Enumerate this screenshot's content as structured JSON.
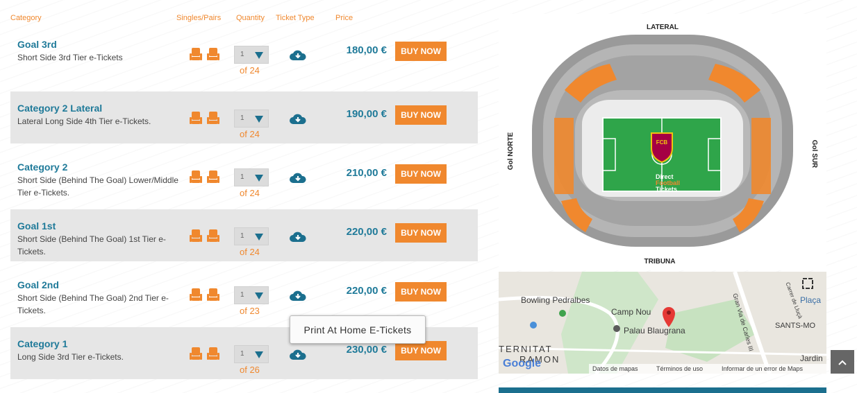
{
  "headers": {
    "category": "Category",
    "singles_pairs": "Singles/Pairs",
    "quantity": "Quantity",
    "ticket_type": "Ticket Type",
    "price": "Price"
  },
  "rows": [
    {
      "name": "Goal 3rd",
      "desc": "Short Side 3rd Tier e-Tickets",
      "qty": "1",
      "of": "of 24",
      "price": "180,00 €",
      "buy": "BUY NOW"
    },
    {
      "name": "Category 2 Lateral",
      "desc": "Lateral Long Side 4th Tier e-Tickets.",
      "qty": "1",
      "of": "of 24",
      "price": "190,00 €",
      "buy": "BUY NOW"
    },
    {
      "name": "Category 2",
      "desc": "Short Side (Behind The Goal) Lower/Middle Tier e-Tickets.",
      "qty": "1",
      "of": "of 24",
      "price": "210,00 €",
      "buy": "BUY NOW"
    },
    {
      "name": "Goal 1st",
      "desc": "Short Side (Behind The Goal) 1st Tier e-Tickets.",
      "qty": "1",
      "of": "of 24",
      "price": "220,00 €",
      "buy": "BUY NOW"
    },
    {
      "name": "Goal 2nd",
      "desc": "Short Side (Behind The Goal) 2nd Tier e-Tickets.",
      "qty": "1",
      "of": "of 23",
      "price": "220,00 €",
      "buy": "BUY NOW"
    },
    {
      "name": "Category 1",
      "desc": "Long Side 3rd Tier e-Tickets.",
      "qty": "1",
      "of": "of 26",
      "price": "230,00 €",
      "buy": "BUY NOW"
    }
  ],
  "tooltip": "Print At Home E-Tickets",
  "stadium": {
    "top": "LATERAL",
    "bottom": "TRIBUNA",
    "left": "Gol NORTE",
    "right": "Gol SUR",
    "crest": "FCB",
    "watermark_1": "Direct",
    "watermark_2": "Football",
    "watermark_3": "Tickets"
  },
  "map": {
    "bowling": "Bowling Pedralbes",
    "camp_nou": "Camp Nou",
    "palau": "Palau Blaugrana",
    "placa": "Plaça",
    "sants": "SANTS-MO",
    "jardin": "Jardin",
    "gran_via": "Gran Via de Carles III",
    "lluca": "Carrer de Lluçà",
    "eternitat": "TERNITAT",
    "ramon": "RAMON",
    "google": "Google",
    "datos": "Datos de mapas",
    "terminos": "Términos de uso",
    "informar": "Informar de un error de Maps"
  },
  "scroll_top_icon": "chevron-up-icon",
  "colors": {
    "accent_orange": "#f0882e",
    "brand_teal": "#1f7a99",
    "row_alt": "#e6e6e6",
    "pitch_green": "#2fa54a"
  }
}
